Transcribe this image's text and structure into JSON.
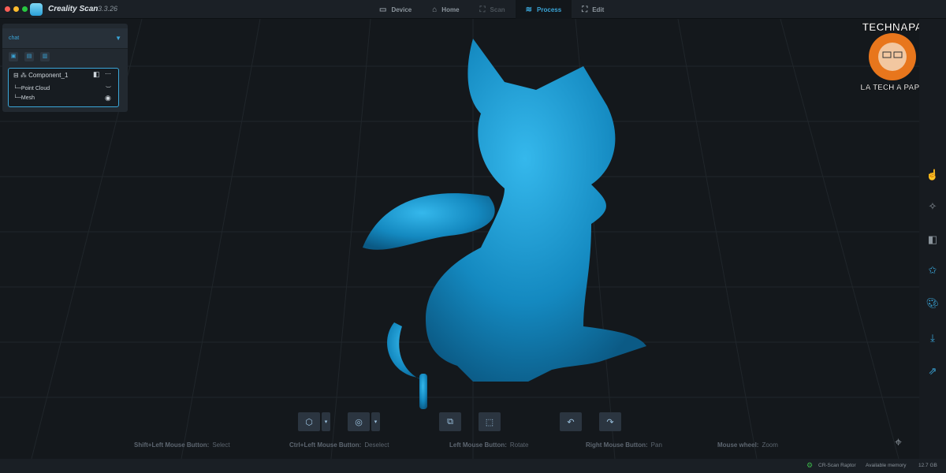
{
  "app": {
    "title": "Creality Scan",
    "version": "3.3.26"
  },
  "tabs": [
    {
      "label": "Device",
      "icon": "device-icon"
    },
    {
      "label": "Home",
      "icon": "home-icon"
    },
    {
      "label": "Scan",
      "icon": "scan-icon"
    },
    {
      "label": "Process",
      "icon": "process-icon"
    },
    {
      "label": "Edit",
      "icon": "edit-icon"
    }
  ],
  "active_tab": "Process",
  "project_panel": {
    "project": "chat",
    "component": "Component_1",
    "children": [
      "Point Cloud",
      "Mesh"
    ]
  },
  "hints": [
    {
      "key": "Shift+Left Mouse Button:",
      "action": "Select"
    },
    {
      "key": "Ctrl+Left Mouse Button:",
      "action": "Deselect"
    },
    {
      "key": "Left Mouse Button:",
      "action": "Rotate"
    },
    {
      "key": "Right Mouse Button:",
      "action": "Pan"
    },
    {
      "key": "Mouse wheel:",
      "action": "Zoom"
    }
  ],
  "status": {
    "device": "CR-Scan Raptor",
    "memory_label": "Available memory",
    "memory_value": "12.7 GB"
  },
  "watermark": {
    "top": "TECHNAPA",
    "bottom": "LA TECH A PAPA"
  },
  "colors": {
    "accent": "#3aa5d8",
    "model": "#1590c8",
    "background": "#14181c"
  }
}
